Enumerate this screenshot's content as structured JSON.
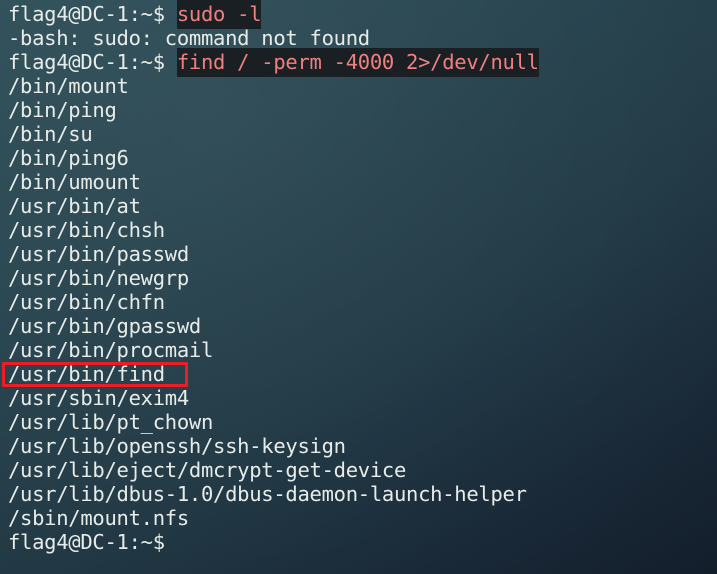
{
  "terminal": {
    "window_title": "flag4@DC-1: ~",
    "colors": {
      "background_top": "#2d4b55",
      "background_bottom": "#1b2838",
      "foreground": "#e8ece8",
      "command_text": "#f08080",
      "command_highlight_bg": "#1a1f24",
      "annotation_red": "#ee1c25"
    },
    "prompt": "flag4@DC-1:~$",
    "user": "flag4",
    "host": "DC-1",
    "cwd": "~",
    "lines": [
      {
        "id": "line-0",
        "type": "prompt-command",
        "prompt": "flag4@DC-1:~$ ",
        "command": "sudo -l"
      },
      {
        "id": "line-1",
        "type": "output",
        "text": "-bash: sudo: command not found"
      },
      {
        "id": "line-2",
        "type": "prompt-command",
        "prompt": "flag4@DC-1:~$ ",
        "command": "find / -perm -4000 2>/dev/null"
      },
      {
        "id": "line-3",
        "type": "output",
        "text": "/bin/mount"
      },
      {
        "id": "line-4",
        "type": "output",
        "text": "/bin/ping"
      },
      {
        "id": "line-5",
        "type": "output",
        "text": "/bin/su"
      },
      {
        "id": "line-6",
        "type": "output",
        "text": "/bin/ping6"
      },
      {
        "id": "line-7",
        "type": "output",
        "text": "/bin/umount"
      },
      {
        "id": "line-8",
        "type": "output",
        "text": "/usr/bin/at"
      },
      {
        "id": "line-9",
        "type": "output",
        "text": "/usr/bin/chsh"
      },
      {
        "id": "line-10",
        "type": "output",
        "text": "/usr/bin/passwd"
      },
      {
        "id": "line-11",
        "type": "output",
        "text": "/usr/bin/newgrp"
      },
      {
        "id": "line-12",
        "type": "output",
        "text": "/usr/bin/chfn"
      },
      {
        "id": "line-13",
        "type": "output",
        "text": "/usr/bin/gpasswd"
      },
      {
        "id": "line-14",
        "type": "output",
        "text": "/usr/bin/procmail"
      },
      {
        "id": "line-15",
        "type": "output",
        "text": "/usr/bin/find",
        "annotated": true
      },
      {
        "id": "line-16",
        "type": "output",
        "text": "/usr/sbin/exim4"
      },
      {
        "id": "line-17",
        "type": "output",
        "text": "/usr/lib/pt_chown"
      },
      {
        "id": "line-18",
        "type": "output",
        "text": "/usr/lib/openssh/ssh-keysign"
      },
      {
        "id": "line-19",
        "type": "output",
        "text": "/usr/lib/eject/dmcrypt-get-device"
      },
      {
        "id": "line-20",
        "type": "output",
        "text": "/usr/lib/dbus-1.0/dbus-daemon-launch-helper"
      },
      {
        "id": "line-21",
        "type": "output",
        "text": "/sbin/mount.nfs"
      },
      {
        "id": "line-22",
        "type": "prompt-only",
        "prompt": "flag4@DC-1:~$",
        "command": ""
      }
    ],
    "annotation": {
      "target_text": "/usr/bin/find",
      "shape": "rectangle",
      "color": "#ee1c25"
    }
  }
}
